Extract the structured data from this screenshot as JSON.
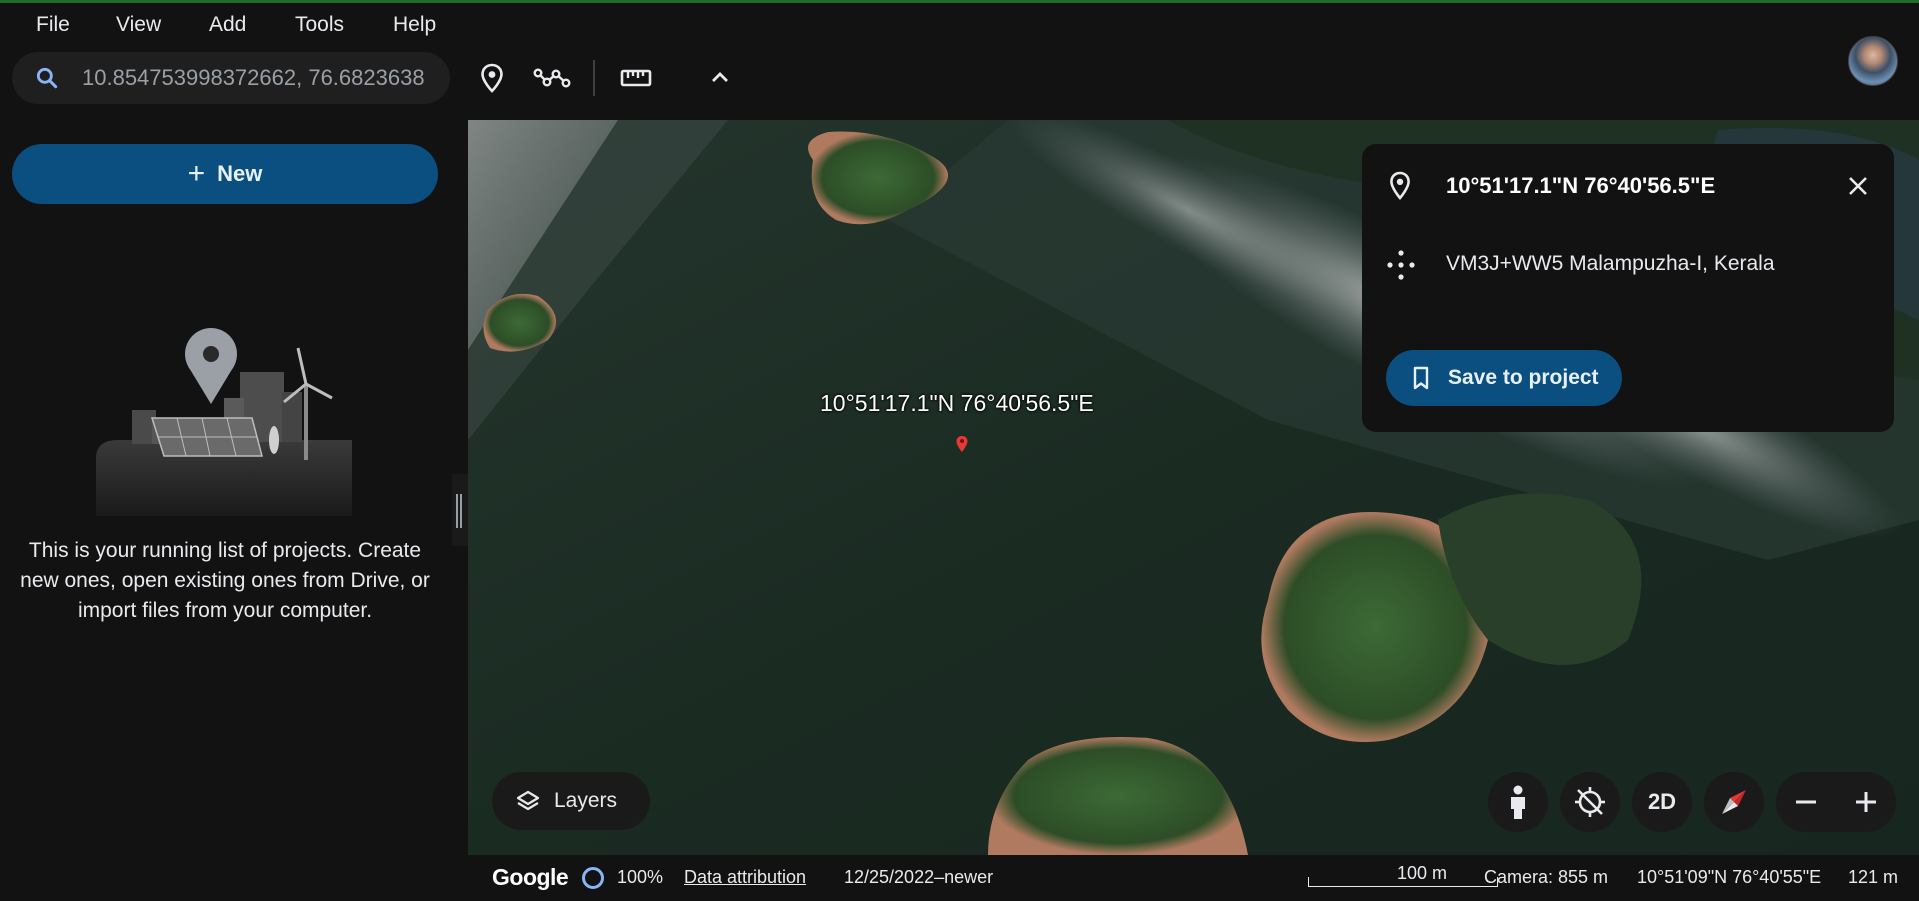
{
  "menu": {
    "file": "File",
    "view": "View",
    "add": "Add",
    "tools": "Tools",
    "help": "Help"
  },
  "search": {
    "value": "10.854753998372662, 76.6823638"
  },
  "toolbar": {
    "icons": [
      "placemark-icon",
      "path-icon",
      "ruler-icon",
      "chevron-up-icon"
    ]
  },
  "sidebar": {
    "new_label": "New",
    "empty_message": "This is your running list of projects. Create new ones, open existing ones from Drive, or import files from your computer."
  },
  "map": {
    "label": "10°51'17.1\"N 76°40'56.5\"E",
    "pin_color": "#e53935"
  },
  "info_card": {
    "title": "10°51'17.1\"N 76°40'56.5\"E",
    "plus_code": "VM3J+WW5 Malampuzha-I, Kerala",
    "save_label": "Save to project"
  },
  "controls": {
    "layers_label": "Layers",
    "mode_2d_label": "2D"
  },
  "status": {
    "brand": "Google",
    "load_percent": "100%",
    "attribution": "Data attribution",
    "imagery_date": "12/25/2022–newer",
    "scale": "100 m",
    "camera": "Camera: 855 m",
    "coordinates": "10°51'09\"N 76°40'55\"E",
    "elevation": "121 m"
  },
  "colors": {
    "accent": "#0b4f80",
    "background": "#121212"
  }
}
